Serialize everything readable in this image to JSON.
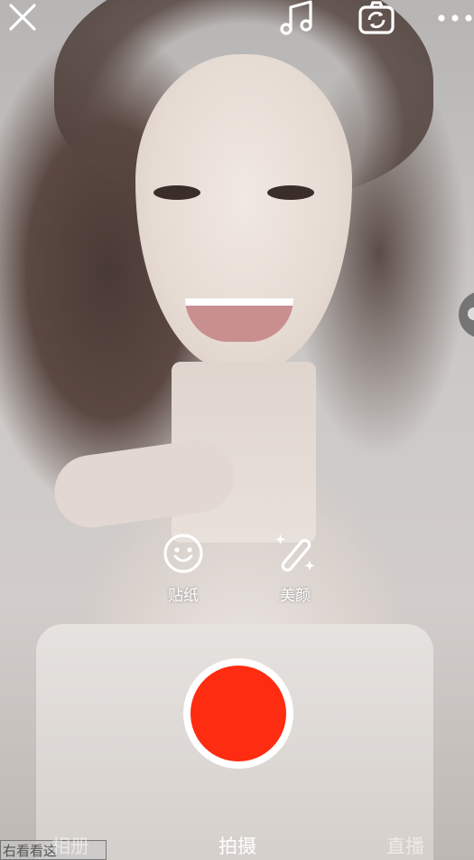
{
  "top_bar": {
    "close_icon": "close-icon",
    "music_icon": "music-icon",
    "flip_icon": "camera-flip-icon",
    "more_icon": "more-icon"
  },
  "tools": [
    {
      "icon": "sticker-icon",
      "label": "贴纸"
    },
    {
      "icon": "beauty-wand-icon",
      "label": "美颜"
    }
  ],
  "record_button": {
    "color": "#fe2c11"
  },
  "tabs": [
    {
      "label": "相册",
      "active": false
    },
    {
      "label": "拍摄",
      "active": true
    },
    {
      "label": "直播",
      "active": false
    }
  ],
  "background_overlay_text": "右看看这"
}
